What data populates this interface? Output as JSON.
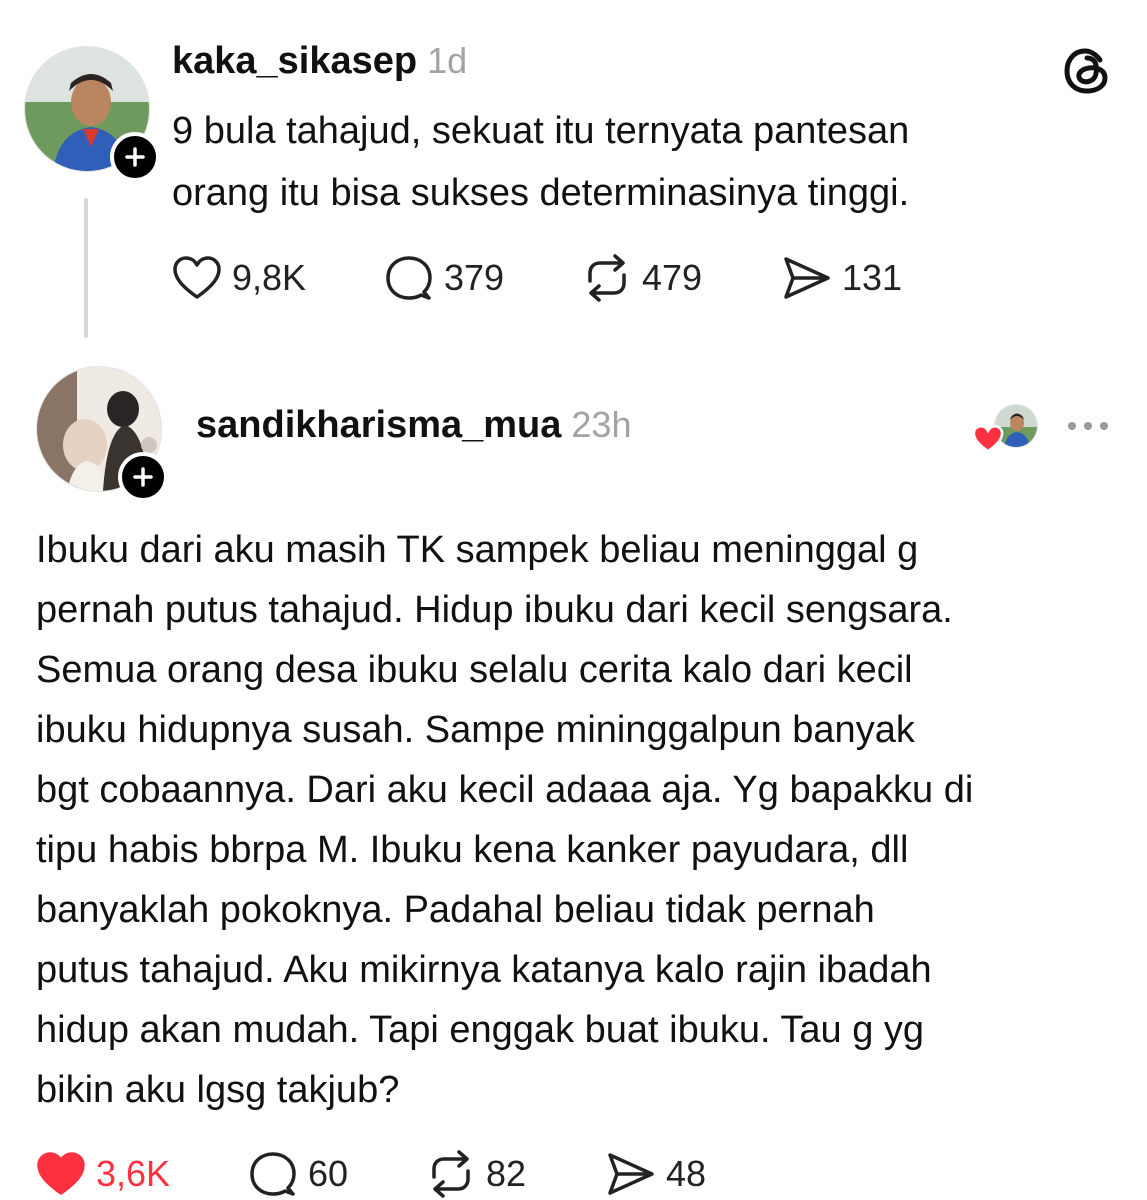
{
  "post": {
    "username": "kaka_sikasep",
    "time": "1d",
    "text": "9 bula tahajud, sekuat itu ternyata pantesan\norang itu bisa sukses determinasinya tinggi.",
    "likes": "9,8K",
    "replies": "379",
    "reposts": "479",
    "shares": "131"
  },
  "reply": {
    "username": "sandikharisma_mua",
    "time": "23h",
    "text": "Ibuku dari aku masih TK sampek beliau meninggal g\npernah putus tahajud. Hidup ibuku dari kecil sengsara.\nSemua orang desa ibuku selalu cerita kalo dari kecil\nibuku hidupnya susah. Sampe mininggalpun banyak\nbgt cobaannya. Dari aku kecil adaaa aja. Yg bapakku di\ntipu habis bbrpa M. Ibuku kena kanker payudara, dll\nbanyaklah pokoknya. Padahal beliau tidak pernah\nputus tahajud. Aku mikirnya katanya kalo rajin ibadah\nhidup akan mudah. Tapi enggak buat ibuku. Tau g yg\nbikin aku lgsg takjub?",
    "likes": "3,6K",
    "replies": "60",
    "reposts": "82",
    "shares": "48"
  },
  "icons": {
    "app_logo": "threads-logo-icon",
    "like": "heart-icon",
    "liked": "heart-filled-icon",
    "reply": "speech-bubble-icon",
    "repost": "repost-icon",
    "share": "send-icon",
    "follow": "plus-icon",
    "more": "more-dots-icon"
  },
  "colors": {
    "liked_red": "#ff3040",
    "muted_text": "#a3a3a3",
    "thread_line": "#d6d6d6"
  }
}
